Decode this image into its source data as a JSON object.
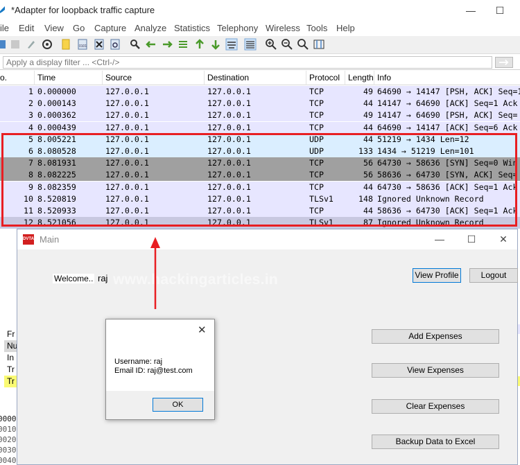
{
  "window": {
    "title": "*Adapter for loopback traffic capture",
    "controls": {
      "minimize": "—",
      "maximize": "☐"
    }
  },
  "menu": [
    "ile",
    "Edit",
    "View",
    "Go",
    "Capture",
    "Analyze",
    "Statistics",
    "Telephony",
    "Wireless",
    "Tools",
    "Help"
  ],
  "filter": {
    "placeholder": "Apply a display filter ... <Ctrl-/>"
  },
  "columns": [
    "o.",
    "Time",
    "Source",
    "Destination",
    "Protocol",
    "Length",
    "Info"
  ],
  "packets": [
    {
      "no": "1",
      "time": "0.000000",
      "src": "127.0.0.1",
      "dst": "127.0.0.1",
      "proto": "TCP",
      "len": "49",
      "info": "64690 → 14147 [PSH, ACK] Seq=1",
      "style": "tcp"
    },
    {
      "no": "2",
      "time": "0.000143",
      "src": "127.0.0.1",
      "dst": "127.0.0.1",
      "proto": "TCP",
      "len": "44",
      "info": "14147 → 64690 [ACK] Seq=1 Ack",
      "style": "tcp"
    },
    {
      "no": "3",
      "time": "0.000362",
      "src": "127.0.0.1",
      "dst": "127.0.0.1",
      "proto": "TCP",
      "len": "49",
      "info": "14147 → 64690 [PSH, ACK] Seq=",
      "style": "tcp"
    },
    {
      "no": "4",
      "time": "0.000439",
      "src": "127.0.0.1",
      "dst": "127.0.0.1",
      "proto": "TCP",
      "len": "44",
      "info": "64690 → 14147 [ACK] Seq=6 Ack",
      "style": "tcp"
    },
    {
      "no": "5",
      "time": "8.005221",
      "src": "127.0.0.1",
      "dst": "127.0.0.1",
      "proto": "UDP",
      "len": "44",
      "info": "51219 → 1434 Len=12",
      "style": "udp"
    },
    {
      "no": "6",
      "time": "8.080528",
      "src": "127.0.0.1",
      "dst": "127.0.0.1",
      "proto": "UDP",
      "len": "133",
      "info": "1434 → 51219 Len=101",
      "style": "udp"
    },
    {
      "no": "7",
      "time": "8.081931",
      "src": "127.0.0.1",
      "dst": "127.0.0.1",
      "proto": "TCP",
      "len": "56",
      "info": "64730 → 58636 [SYN] Seq=0 Win",
      "style": "syn"
    },
    {
      "no": "8",
      "time": "8.082225",
      "src": "127.0.0.1",
      "dst": "127.0.0.1",
      "proto": "TCP",
      "len": "56",
      "info": "58636 → 64730 [SYN, ACK] Seq=",
      "style": "syn"
    },
    {
      "no": "9",
      "time": "8.082359",
      "src": "127.0.0.1",
      "dst": "127.0.0.1",
      "proto": "TCP",
      "len": "44",
      "info": "64730 → 58636 [ACK] Seq=1 Ack",
      "style": "tcp"
    },
    {
      "no": "10",
      "time": "8.520819",
      "src": "127.0.0.1",
      "dst": "127.0.0.1",
      "proto": "TLSv1",
      "len": "148",
      "info": "Ignored Unknown Record",
      "style": "tcp"
    },
    {
      "no": "11",
      "time": "8.520933",
      "src": "127.0.0.1",
      "dst": "127.0.0.1",
      "proto": "TCP",
      "len": "44",
      "info": "58636 → 64730 [ACK] Seq=1 Ack",
      "style": "tcp"
    },
    {
      "no": "12",
      "time": "8.521056",
      "src": "127.0.0.1",
      "dst": "127.0.0.1",
      "proto": "TLSv1",
      "len": "87",
      "info": "Ignored Unknown Record",
      "style": "sel"
    }
  ],
  "detail_fragments": [
    "Fr",
    "Nu",
    "In",
    "Tr",
    "Tr"
  ],
  "hex_fragments": [
    "0000",
    "0010",
    "0020",
    "0030",
    "0040"
  ],
  "watermark": "www.hackingarticles.in",
  "dvta": {
    "logo": "DVTA",
    "title": "Main",
    "welcome_label": "Welcome..",
    "username": "raj",
    "buttons": {
      "view_profile": "View Profile",
      "logout": "Logout",
      "add_expenses": "Add  Expenses",
      "view_expenses": "View Expenses",
      "clear_expenses": "Clear Expenses",
      "backup": "Backup Data to Excel"
    }
  },
  "message_box": {
    "line1": "Username: raj",
    "line2": "Email ID: raj@test.com",
    "ok": "OK"
  },
  "colors": {
    "tcp": "#e7e6ff",
    "udp": "#daeeff",
    "syn": "#a0a0a0",
    "selected": "#c8c8e0",
    "highlight": "#e81e22"
  }
}
